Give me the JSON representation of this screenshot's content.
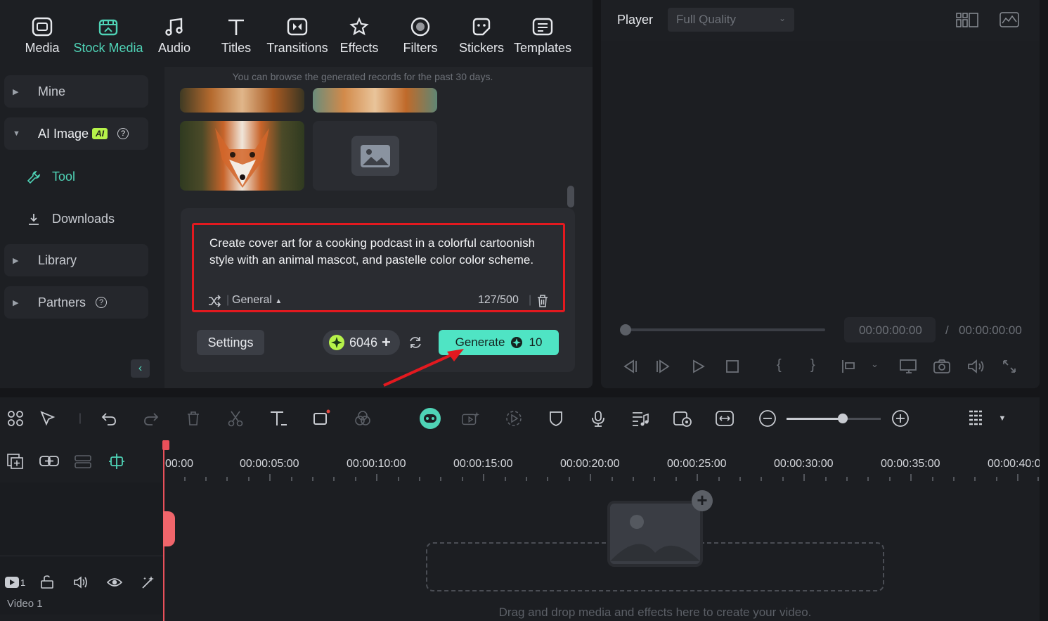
{
  "categories": [
    {
      "label": "Media",
      "icon": "media-icon"
    },
    {
      "label": "Stock Media",
      "icon": "stock-media-icon",
      "active": true
    },
    {
      "label": "Audio",
      "icon": "audio-icon"
    },
    {
      "label": "Titles",
      "icon": "titles-icon"
    },
    {
      "label": "Transitions",
      "icon": "transitions-icon"
    },
    {
      "label": "Effects",
      "icon": "effects-icon"
    },
    {
      "label": "Filters",
      "icon": "filters-icon"
    },
    {
      "label": "Stickers",
      "icon": "stickers-icon"
    },
    {
      "label": "Templates",
      "icon": "templates-icon"
    }
  ],
  "sidebar": {
    "mine": "Mine",
    "ai_image": "AI Image",
    "ai_badge": "AI",
    "tool": "Tool",
    "downloads": "Downloads",
    "library": "Library",
    "partners": "Partners"
  },
  "records_note": "You can browse the generated records for the past 30 days.",
  "prompt": {
    "text": "Create cover art for a cooking podcast in a colorful cartoonish style with an animal mascot, and pastelle color color scheme.",
    "style": "General",
    "count": "127/500"
  },
  "actions": {
    "settings": "Settings",
    "credits": "6046",
    "generate": "Generate",
    "generate_cost": "10"
  },
  "player": {
    "title": "Player",
    "quality": "Full Quality",
    "current_time": "00:00:00:00",
    "separator": "/",
    "total_time": "00:00:00:00"
  },
  "timeline": {
    "ruler": [
      "00:00",
      "00:00:05:00",
      "00:00:10:00",
      "00:00:15:00",
      "00:00:20:00",
      "00:00:25:00",
      "00:00:30:00",
      "00:00:35:00",
      "00:00:40:0"
    ],
    "track_number": "1",
    "track_name": "Video 1",
    "drop_hint": "Drag and drop media and effects here to create your video."
  },
  "colors": {
    "accent": "#4fd3b6",
    "generate": "#4fe4c4",
    "highlight": "#e3191f",
    "badge": "#b6f24a"
  }
}
